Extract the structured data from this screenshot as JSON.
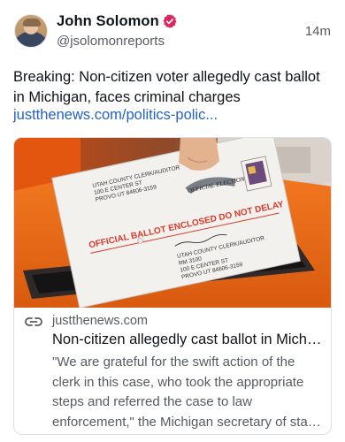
{
  "author": {
    "name": "John Solomon",
    "handle": "@jsolomonreports",
    "timestamp": "14m",
    "verified_color": "#e0245e"
  },
  "post": {
    "text": "Breaking: Non-citizen voter allegedly cast ballot in Michigan, faces criminal charges",
    "link_text": "justthenews.com/politics-polic..."
  },
  "card": {
    "image": {
      "envelope_top_lines": [
        "UTAH COUNTY CLERK/AUDITOR",
        "100 E CENTER ST",
        "PROVO UT 84606-3159"
      ],
      "stamp_text": "OFFICIAL ELECTION MAIL",
      "banner_text": "OFFICIAL BALLOT ENCLOSED DO NOT DELAY",
      "return_lines": [
        "UTAH COUNTY CLERK/AUDITOR",
        "RM 3100",
        "100 E CENTER ST",
        "PROVO UT 84606-3159"
      ]
    },
    "domain": "justthenews.com",
    "title": "Non-citizen allegedly cast ballot in Michigan, faces criminal charges",
    "description": "\"We are grateful for the swift action of the clerk in this case, who took the appropriate steps and referred the case to law enforcement,\" the Michigan secretary of state said."
  },
  "colors": {
    "link": "#2362c7",
    "secondary_text": "#555b62",
    "ballot_red": "#d8392b",
    "box_orange": "#ef6d1c"
  },
  "icons": [
    "avatar",
    "verified-badge-icon",
    "link-icon"
  ]
}
